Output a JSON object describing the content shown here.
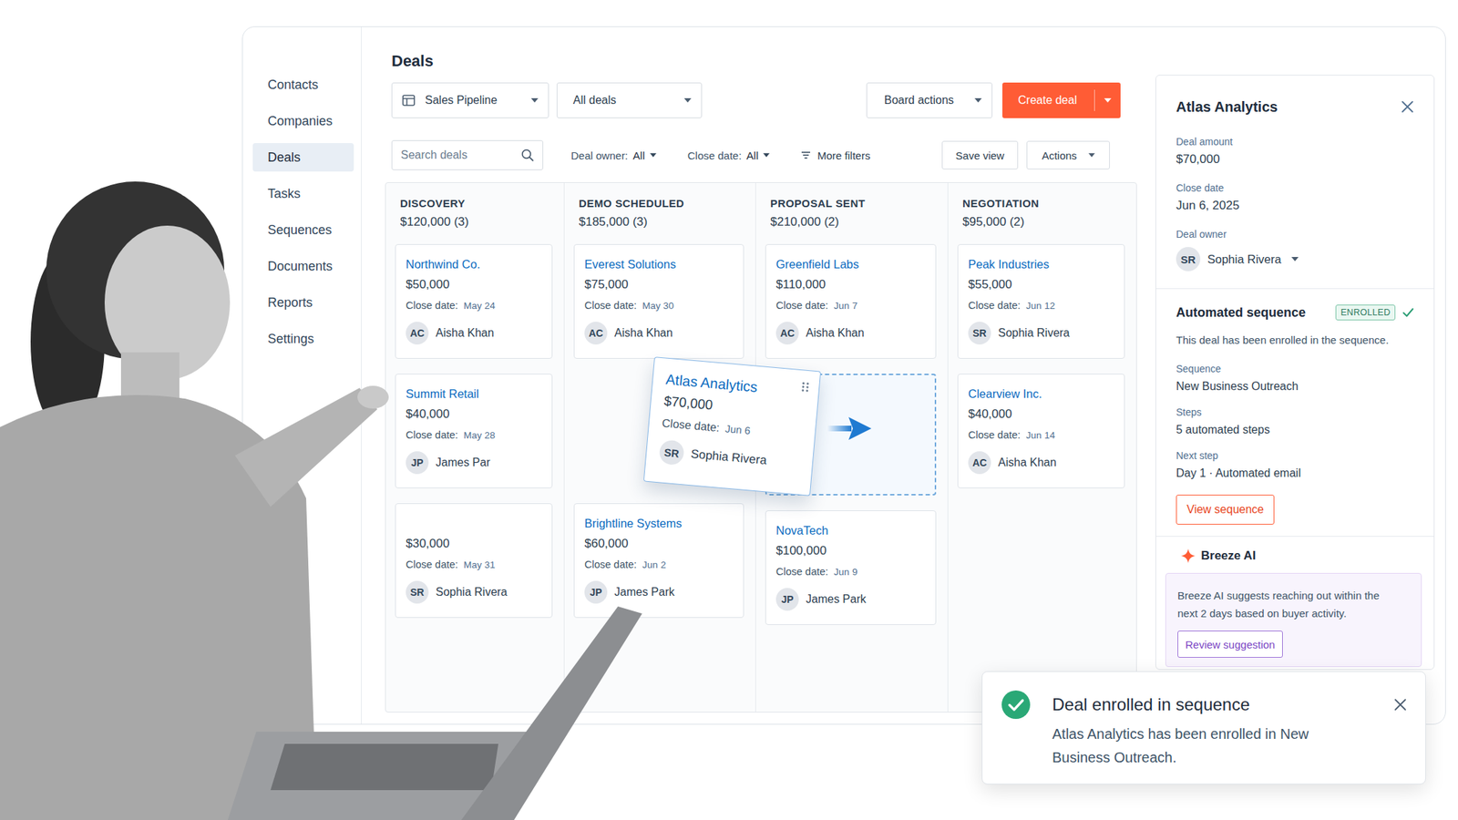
{
  "sidebar": {
    "items": [
      {
        "label": "Contacts",
        "selected": false
      },
      {
        "label": "Companies",
        "selected": false
      },
      {
        "label": "Deals",
        "selected": true
      },
      {
        "label": "Tasks",
        "selected": false
      },
      {
        "label": "Sequences",
        "selected": false
      },
      {
        "label": "Documents",
        "selected": false
      },
      {
        "label": "Reports",
        "selected": false
      },
      {
        "label": "Settings",
        "selected": false
      }
    ]
  },
  "page_title": "Deals",
  "toolbar": {
    "pipeline": "Sales Pipeline",
    "view": "All deals",
    "board_actions": "Board actions",
    "create_deal": "Create deal"
  },
  "filters": {
    "search_placeholder": "Search deals",
    "items": [
      {
        "label": "Deal owner:",
        "value": "All"
      },
      {
        "label": "Close date:",
        "value": "All"
      }
    ],
    "more_filters": "More filters",
    "save_view": "Save view",
    "actions": "Actions"
  },
  "board": {
    "close_label": "Close date:",
    "columns": [
      {
        "title": "DISCOVERY",
        "summary": "$120,000 (3)",
        "cards": [
          {
            "kind": "deal",
            "name": "Northwind Co.",
            "amount": "$50,000",
            "close": "May 24",
            "initials": "AC",
            "owner": "Aisha Khan"
          },
          {
            "kind": "deal",
            "name": "Summit Retail",
            "amount": "$40,000",
            "close": "May 28",
            "initials": "JP",
            "owner": "James Par"
          },
          {
            "kind": "deal",
            "amount": "$30,000",
            "close": "May 31",
            "initials": "SR",
            "owner": "Sophia Rivera"
          }
        ]
      },
      {
        "title": "DEMO SCHEDULED",
        "summary": "$185,000 (3)",
        "cards": [
          {
            "kind": "deal",
            "name": "Everest Solutions",
            "amount": "$75,000",
            "close": "May 30",
            "initials": "AC",
            "owner": "Aisha Khan"
          },
          {
            "kind": "empty"
          },
          {
            "kind": "deal",
            "name": "Brightline Systems",
            "amount": "$60,000",
            "close": "Jun 2",
            "initials": "JP",
            "owner": "James Park"
          }
        ]
      },
      {
        "title": "PROPOSAL SENT",
        "summary": "$210,000 (2)",
        "cards": [
          {
            "kind": "deal",
            "name": "Greenfield Labs",
            "amount": "$110,000",
            "close": "Jun 7",
            "initials": "AC",
            "owner": "Aisha Khan"
          },
          {
            "kind": "drop-target"
          },
          {
            "kind": "deal",
            "name": "NovaTech",
            "amount": "$100,000",
            "close": "Jun 9",
            "initials": "JP",
            "owner": "James Park"
          }
        ]
      },
      {
        "title": "NEGOTIATION",
        "summary": "$95,000 (2)",
        "cards": [
          {
            "kind": "deal",
            "name": "Peak Industries",
            "amount": "$55,000",
            "close": "Jun 12",
            "initials": "SR",
            "owner": "Sophia Rivera"
          },
          {
            "kind": "deal",
            "name": "Clearview Inc.",
            "amount": "$40,000",
            "close": "Jun 14",
            "initials": "AC",
            "owner": "Aisha Khan"
          }
        ]
      }
    ]
  },
  "dragged_card": {
    "name": "Atlas Analytics",
    "amount": "$70,000",
    "close_label": "Close date:",
    "close": "Jun 6",
    "initials": "SR",
    "owner": "Sophia Rivera"
  },
  "detail_panel": {
    "title": "Atlas Analytics",
    "fields": [
      {
        "label": "Deal amount",
        "value": "$70,000"
      },
      {
        "label": "Close date",
        "value": "Jun 6, 2025"
      }
    ],
    "owner_label": "Deal owner",
    "owner_initials": "SR",
    "owner": "Sophia Rivera",
    "sequence": {
      "title": "Automated sequence",
      "badge": "ENROLLED",
      "enrolled": true,
      "description": "This deal has been enrolled in the sequence.",
      "fields": [
        {
          "label": "Sequence",
          "value": "New Business Outreach"
        },
        {
          "label": "Steps",
          "value": "5 automated steps"
        },
        {
          "label": "Next step",
          "value": "Day 1 · Automated email"
        }
      ],
      "button": "View sequence"
    },
    "ai": {
      "title": "Breeze AI",
      "suggestion": "Breeze AI suggests reaching out within the next 2 days based on buyer activity.",
      "button": "Review suggestion"
    }
  },
  "toast": {
    "title": "Deal enrolled in sequence",
    "message": "Atlas Analytics has been enrolled in New Business Outreach."
  }
}
